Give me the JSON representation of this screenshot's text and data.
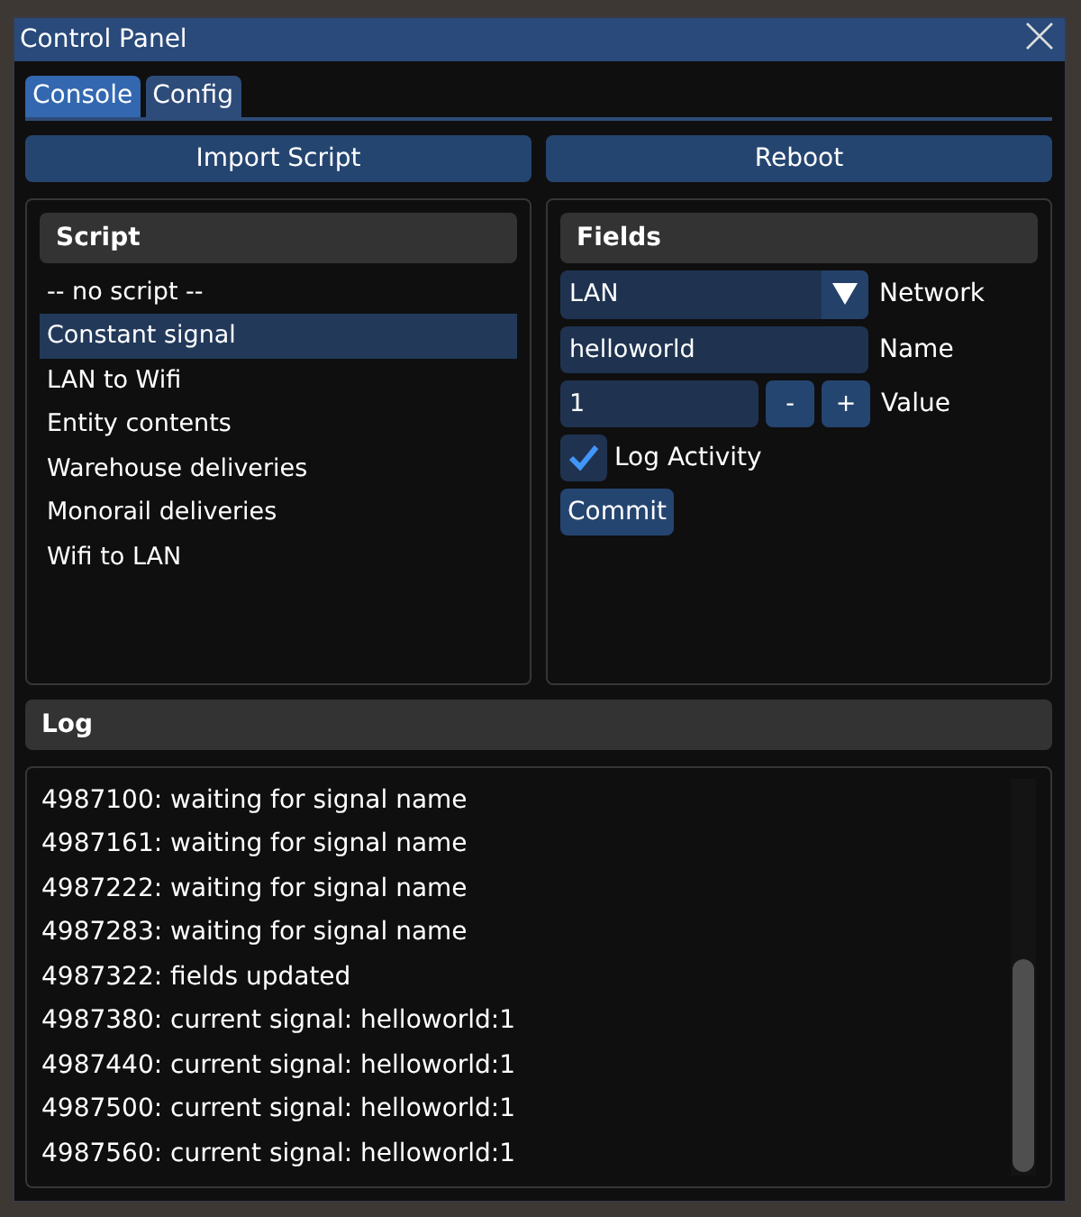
{
  "window": {
    "title": "Control Panel"
  },
  "tabs": [
    {
      "label": "Console",
      "selected": true
    },
    {
      "label": "Config",
      "selected": false
    }
  ],
  "buttons": [
    "Import Script",
    "Reboot"
  ],
  "script_panel": {
    "header": "Script",
    "items": [
      {
        "label": "-- no script --",
        "selected": false
      },
      {
        "label": "Constant signal",
        "selected": true
      },
      {
        "label": "LAN to Wifi",
        "selected": false
      },
      {
        "label": "Entity contents",
        "selected": false
      },
      {
        "label": "Warehouse deliveries",
        "selected": false
      },
      {
        "label": "Monorail deliveries",
        "selected": false
      },
      {
        "label": "Wifi to LAN",
        "selected": false
      }
    ]
  },
  "fields_panel": {
    "header": "Fields",
    "rows": [
      {
        "kind": "combo",
        "value": "LAN",
        "label": "Network"
      },
      {
        "kind": "text",
        "value": "helloworld",
        "label": "Name"
      },
      {
        "kind": "stepper",
        "value": "1",
        "minus": "-",
        "plus": "+",
        "label": "Value"
      },
      {
        "kind": "checkbox",
        "checked": true,
        "label": "Log Activity"
      },
      {
        "kind": "button",
        "label": "Commit"
      }
    ]
  },
  "log": {
    "header": "Log",
    "lines": [
      "4987100: waiting for signal name",
      "4987161: waiting for signal name",
      "4987222: waiting for signal name",
      "4987283: waiting for signal name",
      "4987322: fields updated",
      "4987380: current signal: helloworld:1",
      "4987440: current signal: helloworld:1",
      "4987500: current signal: helloworld:1",
      "4987560: current signal: helloworld:1"
    ]
  }
}
